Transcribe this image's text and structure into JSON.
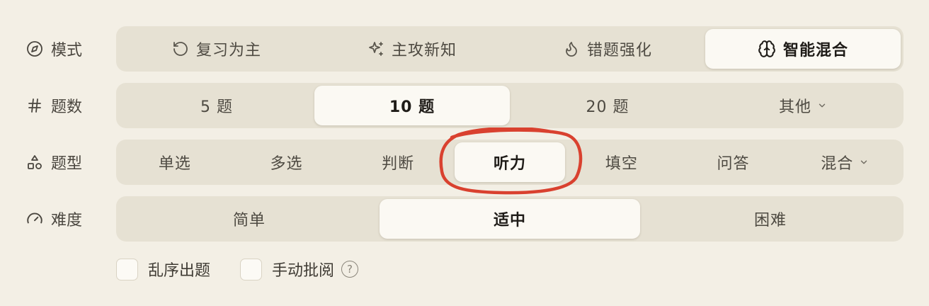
{
  "mode": {
    "label": "模式",
    "icon": "compass-icon",
    "options": [
      {
        "label": "复习为主",
        "icon": "rotate-ccw-icon"
      },
      {
        "label": "主攻新知",
        "icon": "sparkles-icon"
      },
      {
        "label": "错题强化",
        "icon": "flame-icon"
      },
      {
        "label": "智能混合",
        "icon": "brain-icon"
      }
    ],
    "selected": "智能混合"
  },
  "count": {
    "label": "题数",
    "icon": "hash-icon",
    "options": [
      "5 题",
      "10 题",
      "20 题",
      "其他"
    ],
    "selected": "10 题"
  },
  "types": {
    "label": "题型",
    "icon": "shapes-icon",
    "options": [
      "单选",
      "多选",
      "判断",
      "听力",
      "填空",
      "问答",
      "混合"
    ],
    "selected": "听力"
  },
  "difficulty": {
    "label": "难度",
    "icon": "gauge-icon",
    "options": [
      "简单",
      "适中",
      "困难"
    ],
    "selected": "适中"
  },
  "checkboxes": [
    {
      "label": "乱序出题",
      "checked": false
    },
    {
      "label": "手动批阅",
      "checked": false,
      "help_icon": "help-circle-icon",
      "help_glyph": "?"
    }
  ],
  "colors": {
    "background": "#f3efe5",
    "segment_track": "#e6e1d3",
    "active_option": "#fbf9f3",
    "annotation_circle": "#d9412f"
  }
}
